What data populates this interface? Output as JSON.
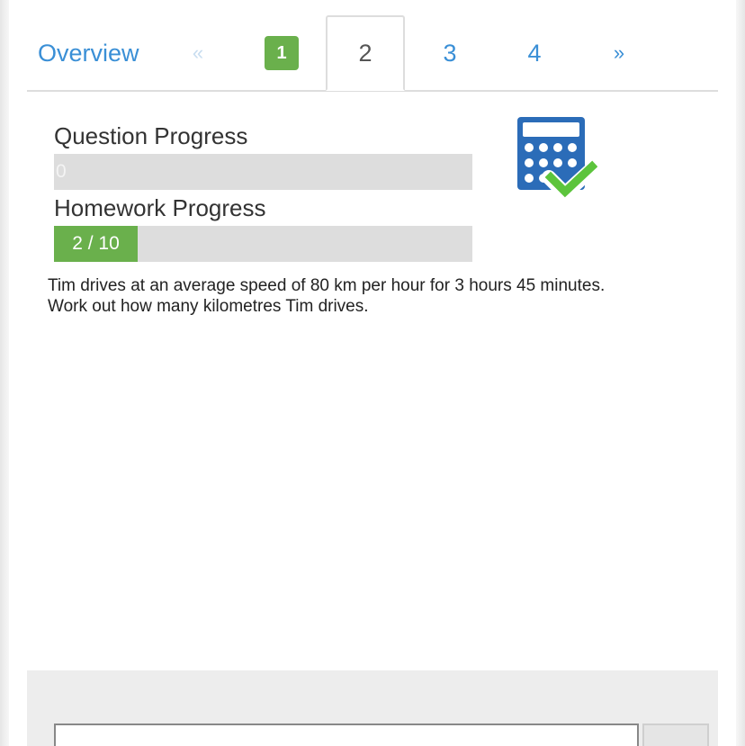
{
  "tabs": {
    "overview": "Overview",
    "prev": "«",
    "page1": "1",
    "page2": "2",
    "page3": "3",
    "page4": "4",
    "next": "»"
  },
  "question_progress": {
    "label": "Question Progress",
    "text": "0",
    "fraction": 0
  },
  "homework_progress": {
    "label": "Homework Progress",
    "text": "2 / 10",
    "fraction": 0.2
  },
  "question": {
    "line1": "Tim drives at an average speed of 80 km per hour for 3 hours 45 minutes.",
    "line2": "Work out how many kilometres Tim drives."
  },
  "icons": {
    "calculator": "calculator-check-icon"
  },
  "colors": {
    "accent": "#3a8fd6",
    "success": "#6ab04c",
    "calculator": "#2b6cb8",
    "check": "#5cc43c"
  }
}
